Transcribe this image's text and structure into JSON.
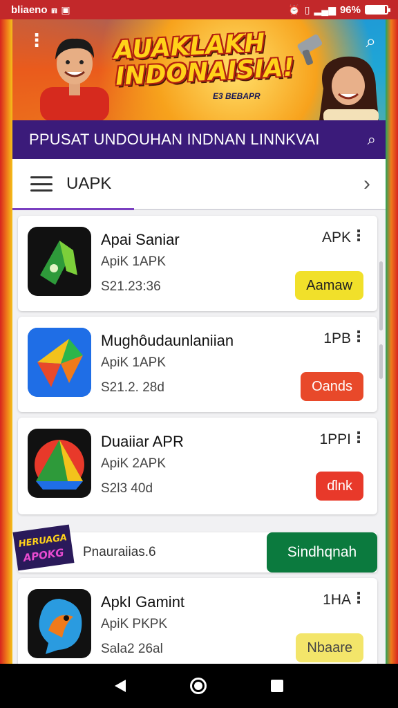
{
  "status_bar": {
    "carrier": "bliaeno",
    "battery_text": "96%",
    "battery_level": 0.9
  },
  "banner": {
    "title_line1": "AUAKLAKH",
    "title_line2": "INDONAISIA!",
    "subtitle": "E3 BEBAPR"
  },
  "subtitle_bar": {
    "text": "PPUSAT UNDOUHAN INDNAN LINNKVAI"
  },
  "nav": {
    "title": "UAPK"
  },
  "apps": [
    {
      "name": "Apai Saniar",
      "type": "ApiK 1APK",
      "size": "S21.23:36",
      "tag": "APK",
      "button": "Aamaw",
      "button_color": "#f1e02a",
      "button_text_color": "#222222",
      "icon": "green-arrow-icon"
    },
    {
      "name": "Mughôudaunlaniian",
      "type": "ApiK 1APK",
      "size": "S21.2. 28d",
      "tag": "1PB",
      "button": "Oands",
      "button_color": "#e8492a",
      "button_text_color": "#ffffff",
      "icon": "colorful-arrow-icon"
    },
    {
      "name": "Duaiiar APR",
      "type": "ApiK 2APK",
      "size": "S2l3 40d",
      "tag": "1PPI",
      "button": "ɗlnk",
      "button_color": "#e8392a",
      "button_text_color": "#ffffff",
      "icon": "drive-triangle-icon"
    },
    {
      "name": "ApkI Gamint",
      "type": "ApiK PKPK",
      "size": "Sala2 26al",
      "tag": "1HA",
      "button": "Nbaare",
      "button_color": "#f3e56a",
      "button_text_color": "#444444",
      "icon": "bird-head-icon"
    }
  ],
  "ad": {
    "logo_text_1": "HERUAGA",
    "logo_text_2": "APOKG",
    "text": "Pnauraiias.6",
    "button": "Sindhqnah"
  }
}
